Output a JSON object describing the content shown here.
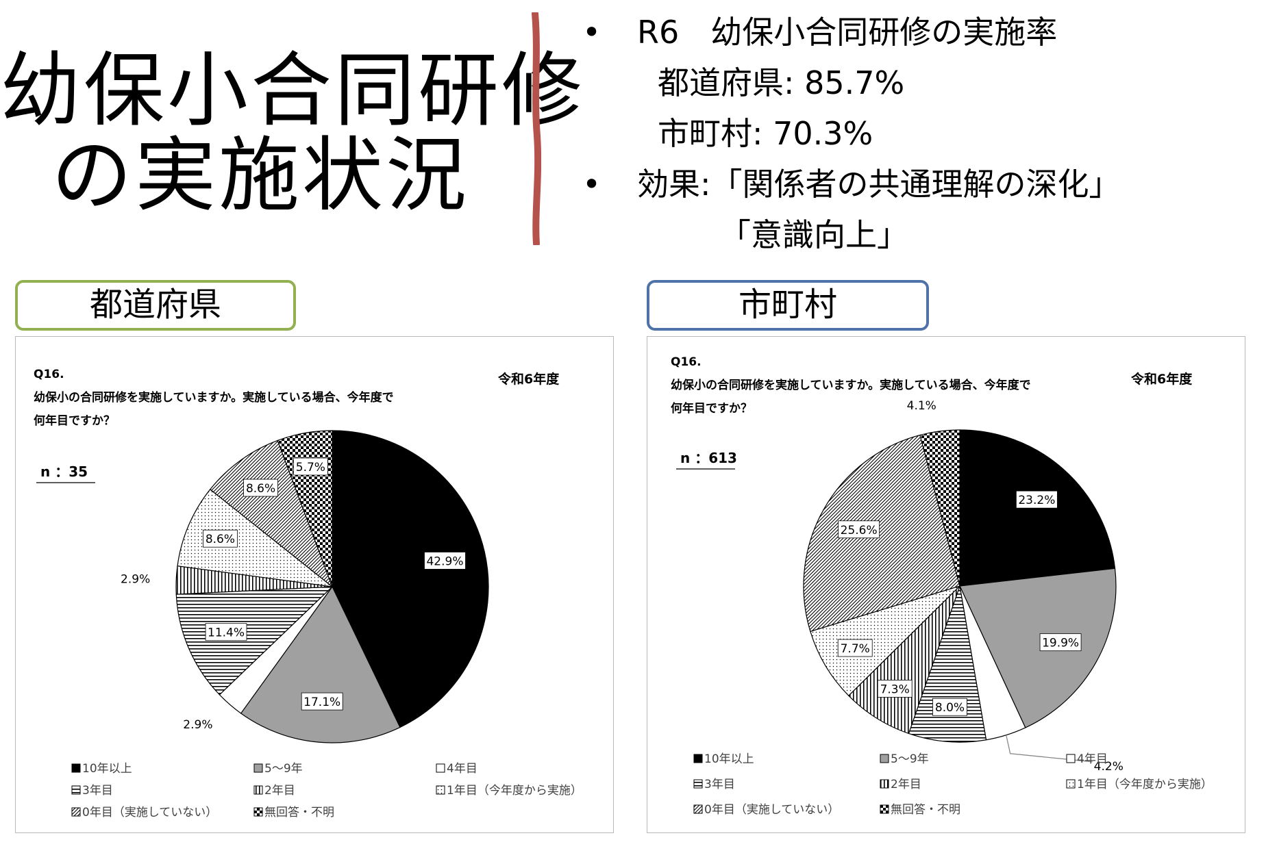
{
  "title": {
    "line1": "幼保小合同研修",
    "line2": "の実施状況"
  },
  "bullets": {
    "marker": "•",
    "rate_heading": "R6　幼保小合同研修の実施率",
    "pref_rate": "都道府県: 85.7%",
    "muni_rate": "市町村: 70.3%",
    "effect_line1": "効果:「関係者の共通理解の深化」",
    "effect_line2": "「意識向上」"
  },
  "colors": {
    "divider": "#B5524C",
    "pref_frame": "#92B050",
    "muni_frame": "#4F73A8"
  },
  "panels": {
    "pref_header": "都道府県",
    "muni_header": "市町村"
  },
  "legend_items": [
    "10年以上",
    "5〜9年",
    "4年目",
    "3年目",
    "2年目",
    "1年目（今年度から実施）",
    "0年目（実施していない）",
    "無回答・不明"
  ],
  "chart_data": [
    {
      "type": "pie",
      "question_id": "Q16.",
      "question_line1": "幼保小の合同研修を実施していますか。実施している場合、今年度で",
      "question_line2": "何年目ですか？",
      "year_label": "令和6年度",
      "n_label": "n ：35",
      "categories": [
        "10年以上",
        "5〜9年",
        "4年目",
        "3年目",
        "2年目",
        "1年目（今年度から実施）",
        "0年目（実施していない）",
        "無回答・不明"
      ],
      "values": [
        42.9,
        17.1,
        2.9,
        11.4,
        2.9,
        8.6,
        8.6,
        5.7
      ],
      "labels": [
        "42.9%",
        "17.1%",
        "2.9%",
        "11.4%",
        "2.9%",
        "8.6%",
        "8.6%",
        "5.7%"
      ],
      "fills": [
        "solid-black",
        "solid-gray",
        "white",
        "horizontal-lines",
        "vertical-lines",
        "dots",
        "diagonal-hatch",
        "checker"
      ]
    },
    {
      "type": "pie",
      "question_id": "Q16.",
      "question_line1": "幼保小の合同研修を実施していますか。実施している場合、今年度で",
      "question_line2": "何年目ですか？",
      "year_label": "令和6年度",
      "n_label": "n ：613",
      "categories": [
        "10年以上",
        "5〜9年",
        "4年目",
        "3年目",
        "2年目",
        "1年目（今年度から実施）",
        "0年目（実施していない）",
        "無回答・不明"
      ],
      "values": [
        23.2,
        19.9,
        4.2,
        8.0,
        7.3,
        7.7,
        25.6,
        4.1
      ],
      "labels": [
        "23.2%",
        "19.9%",
        "4.2%",
        "8.0%",
        "7.3%",
        "7.7%",
        "25.6%",
        "4.1%"
      ],
      "fills": [
        "solid-black",
        "solid-gray",
        "white",
        "horizontal-lines",
        "vertical-lines",
        "dots",
        "diagonal-hatch",
        "checker"
      ]
    }
  ]
}
